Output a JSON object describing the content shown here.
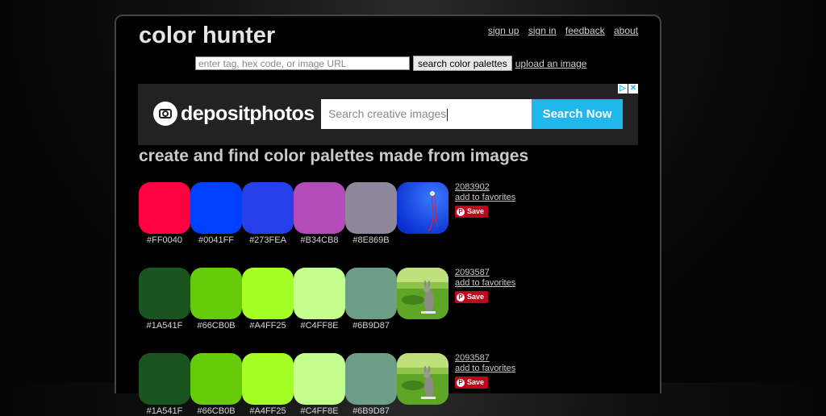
{
  "header": {
    "logo": "color hunter",
    "links": [
      "sign up",
      "sign in",
      "feedback",
      "about"
    ],
    "search_placeholder": "enter tag, hex code, or image URL",
    "search_button": "search color palettes",
    "upload_link": "upload an image"
  },
  "ad": {
    "brand": "depositphotos",
    "placeholder": "Search creative images",
    "button": "Search Now"
  },
  "heading": "create and find color palettes made from images",
  "palettes": [
    {
      "id": "2083902",
      "favorites": "add to favorites",
      "save": "Save",
      "colors": [
        "#FF0040",
        "#0041FF",
        "#273FEA",
        "#B34CB8",
        "#8E869B"
      ],
      "thumb": "blue-background-red-earphones"
    },
    {
      "id": "2093587",
      "favorites": "add to favorites",
      "save": "Save",
      "colors": [
        "#1A541F",
        "#66CB0B",
        "#A4FF25",
        "#C4FF8E",
        "#6B9D87"
      ],
      "thumb": "wallaby-on-grass"
    },
    {
      "id": "2093587",
      "favorites": "add to favorites",
      "save": "Save",
      "colors": [
        "#1A541F",
        "#66CB0B",
        "#A4FF25",
        "#C4FF8E",
        "#6B9D87"
      ],
      "thumb": "wallaby-on-grass"
    }
  ],
  "colors": {
    "pinterest_red": "#bd081c",
    "ad_button": "#1fb7ec"
  }
}
